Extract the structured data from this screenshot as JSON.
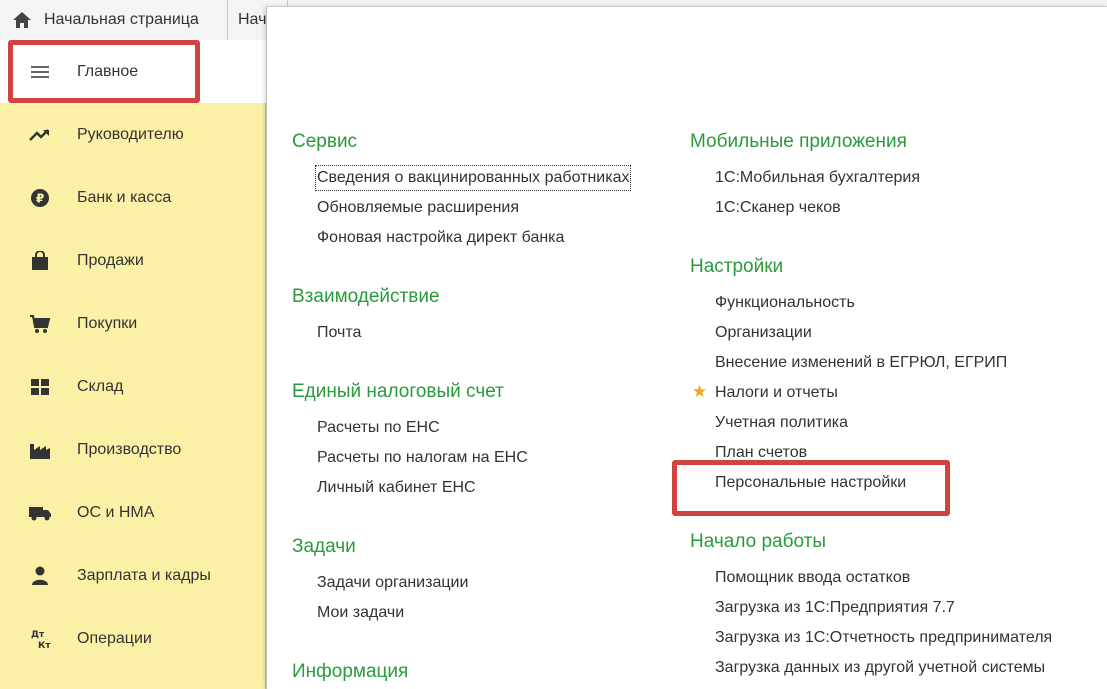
{
  "tabs": {
    "home": "Начальная страница",
    "second": "Нача"
  },
  "sidebar": {
    "items": [
      {
        "label": "Главное",
        "icon": "menu-icon"
      },
      {
        "label": "Руководителю",
        "icon": "trend-up-icon"
      },
      {
        "label": "Банк и касса",
        "icon": "ruble-icon"
      },
      {
        "label": "Продажи",
        "icon": "shopping-bag-icon"
      },
      {
        "label": "Покупки",
        "icon": "cart-icon"
      },
      {
        "label": "Склад",
        "icon": "warehouse-grid-icon"
      },
      {
        "label": "Производство",
        "icon": "factory-icon"
      },
      {
        "label": "ОС и НМА",
        "icon": "truck-icon"
      },
      {
        "label": "Зарплата и кадры",
        "icon": "person-icon"
      },
      {
        "label": "Операции",
        "icon": "debit-credit-icon",
        "icon_text": {
          "top": "Дт",
          "bottom": "Кт"
        }
      }
    ]
  },
  "left_column": {
    "service": {
      "title": "Сервис",
      "links": [
        "Сведения о вакцинированных работниках",
        "Обновляемые расширения",
        "Фоновая настройка директ банка"
      ]
    },
    "interaction": {
      "title": "Взаимодействие",
      "links": [
        "Почта"
      ]
    },
    "ens": {
      "title": "Единый налоговый счет",
      "links": [
        "Расчеты по ЕНС",
        "Расчеты по налогам на ЕНС",
        "Личный кабинет ЕНС"
      ]
    },
    "tasks": {
      "title": "Задачи",
      "links": [
        "Задачи организации",
        "Мои задачи"
      ]
    },
    "info": {
      "title": "Информация"
    }
  },
  "right_column": {
    "mobile": {
      "title": "Мобильные приложения",
      "links": [
        "1С:Мобильная бухгалтерия",
        "1С:Сканер чеков"
      ]
    },
    "settings": {
      "title": "Настройки",
      "links": [
        "Функциональность",
        "Организации",
        "Внесение изменений в ЕГРЮЛ, ЕГРИП",
        "Налоги и отчеты",
        "Учетная политика",
        "План счетов",
        "Персональные настройки"
      ]
    },
    "start": {
      "title": "Начало работы",
      "links": [
        "Помощник ввода остатков",
        "Загрузка из 1С:Предприятия 7.7",
        "Загрузка из 1С:Отчетность предпринимателя",
        "Загрузка данных из другой учетной системы"
      ]
    }
  },
  "colors": {
    "sidebar_bg": "#fbf1a6",
    "section_title": "#2a9a3d",
    "highlight": "#d1433f",
    "star": "#f1a41a"
  }
}
